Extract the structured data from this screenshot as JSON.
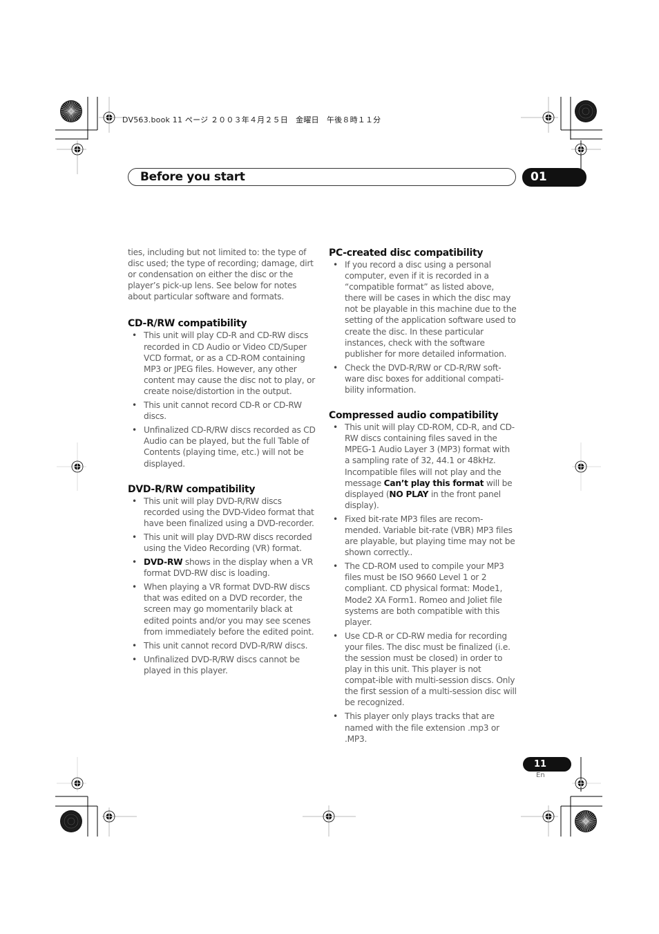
{
  "print_info": "DV563.book  11 ページ  ２００３年４月２５日　金曜日　午後８時１１分",
  "header": {
    "title": "Before you start",
    "chapter": "01"
  },
  "left_column": {
    "intro": "ties, including but not limited to: the type of disc used; the type of recording; damage, dirt or condensation on either the disc or the player’s pick-up lens. See below for notes about particular software and formats.",
    "sections": [
      {
        "heading": "CD-R/RW compatibility",
        "items": [
          "This unit will play CD-R and CD-RW discs recorded in CD Audio or Video CD/Super VCD format, or as a CD-ROM containing MP3 or JPEG files. However, any other content may cause the disc not to play, or create noise/distortion in the output.",
          "This unit cannot record CD-R or CD-RW discs.",
          "Unfinalized CD-R/RW discs recorded as CD Audio can be played, but the full Table of Contents (playing time, etc.) will not be displayed."
        ]
      },
      {
        "heading": "DVD-R/RW compatibility",
        "items": [
          "This unit will play DVD-R/RW discs recorded using the DVD-Video format that have been finalized using a DVD-recorder.",
          "This unit will play DVD-RW discs recorded using the Video Recording (VR) format.",
          {
            "bold": "DVD-RW",
            "text": " shows in the display when a VR format DVD-RW disc is loading."
          },
          "When playing a VR format DVD-RW discs that was edited on a DVD recorder, the screen may go momentarily black at edited points and/or you may see scenes from immediately before the edited point.",
          "This unit cannot record DVD-R/RW discs.",
          "Unfinalized DVD-R/RW discs cannot be played in this player."
        ]
      }
    ]
  },
  "right_column": {
    "sections": [
      {
        "heading": "PC-created disc compatibility",
        "items": [
          "If you record a disc using a personal computer, even if it is recorded in a “compatible format” as listed above, there will be cases in which the disc may not be playable in this machine due to the setting of the application software used to create the disc. In these particular instances, check with the software publisher for more detailed information.",
          "Check the DVD-R/RW or CD-R/RW soft-ware disc boxes for additional compati-bility information."
        ]
      },
      {
        "heading": "Compressed audio compatibility",
        "items": [
          {
            "part1": "This unit will play CD-ROM, CD-R, and CD-RW discs containing files saved in the MPEG-1 Audio Layer 3 (MP3) format with a sampling rate of 32, 44.1 or 48kHz. Incompatible files will not play and the message ",
            "bold1": "Can’t play this format",
            "part2": " will be displayed (",
            "bold2": "NO PLAY",
            "part3": " in the front panel display)."
          },
          "Fixed bit-rate MP3 files are recom-mended. Variable bit-rate (VBR) MP3 files are playable, but playing time may not be shown correctly..",
          "The CD-ROM used to compile your MP3 files must be ISO 9660 Level 1 or 2 compliant. CD physical format: Mode1, Mode2 XA Form1. Romeo and Joliet file systems are both compatible with this player.",
          "Use CD-R or CD-RW media for recording your files. The disc must be finalized (i.e. the session must be closed) in order to play in this unit. This player is not compat-ible with multi-session discs. Only the first session of a multi-session disc will be recognized.",
          "This player only plays tracks that are named with the file extension .mp3 or .MP3."
        ]
      }
    ]
  },
  "footer": {
    "page_number": "11",
    "language": "En"
  }
}
